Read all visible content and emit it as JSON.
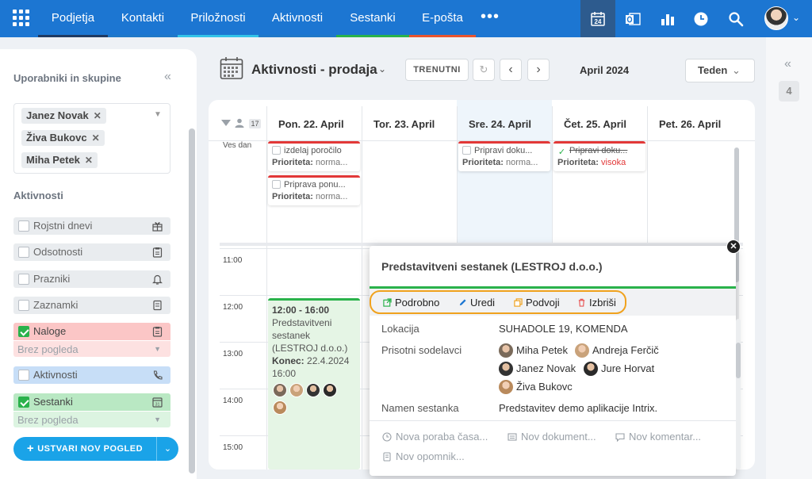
{
  "topnav": {
    "items": [
      {
        "label": "Podjetja",
        "color": "#1f3a63"
      },
      {
        "label": "Kontakti",
        "color": "#1f78c8"
      },
      {
        "label": "Priložnosti",
        "color": "#33c3e8"
      },
      {
        "label": "Aktivnosti",
        "color": "#1f78c8"
      },
      {
        "label": "Sestanki",
        "color": "#2ab24b"
      },
      {
        "label": "E-pošta",
        "color": "#e8542f"
      }
    ],
    "more": "•••",
    "calendar_icon_day": "24"
  },
  "left": {
    "header": "Uporabniki in skupine",
    "users": [
      {
        "name": "Janez Novak",
        "remove": "✕"
      },
      {
        "name": "Živa Bukovc",
        "remove": "✕"
      },
      {
        "name": "Miha Petek",
        "remove": "✕"
      }
    ],
    "activities_title": "Aktivnosti",
    "activities": [
      {
        "label": "Rojstni dnevi",
        "checked": false,
        "bg": "#e9ecef",
        "icon": "gift-icon"
      },
      {
        "label": "Odsotnosti",
        "checked": false,
        "bg": "#e9ecef",
        "icon": "clipboard-icon"
      },
      {
        "label": "Prazniki",
        "checked": false,
        "bg": "#e9ecef",
        "icon": "bell-icon"
      },
      {
        "label": "Zaznamki",
        "checked": false,
        "bg": "#e9ecef",
        "icon": "note-icon"
      },
      {
        "label": "Naloge",
        "checked": true,
        "bg": "#fbc6c6",
        "icon": "clipboard-icon",
        "sub": "Brez pogleda",
        "sub_bg": "#fde1e1"
      },
      {
        "label": "Aktivnosti",
        "checked": false,
        "bg": "#c7def7",
        "icon": "phone-icon"
      },
      {
        "label": "Sestanki",
        "checked": true,
        "bg": "#b9e8c3",
        "icon": "calendar-31-icon",
        "sub": "Brez pogleda",
        "sub_bg": "#dcf4e1"
      }
    ],
    "create_button": "USTVARI NOV POGLED",
    "sub_caret": "▼",
    "users_caret": "▼",
    "collapse": "«"
  },
  "toolbar": {
    "title": "Aktivnosti - prodaja",
    "title_caret": "⌄",
    "today_button": "TRENUTNI",
    "refresh": "↻",
    "prev": "‹",
    "next": "›",
    "date": "April 2024",
    "view": "Teden",
    "view_caret": "⌄"
  },
  "calendar": {
    "week_badge": "17",
    "days": [
      "Pon. 22. April",
      "Tor. 23. April",
      "Sre. 24. April",
      "Čet. 25. April",
      "Pet. 26. April"
    ],
    "all_day_label": "Ves dan",
    "times": [
      "11:00",
      "12:00",
      "13:00",
      "14:00",
      "15:00"
    ],
    "tasks": [
      {
        "title": "izdelaj poročilo",
        "label": "Prioriteta:",
        "priority": "norma...",
        "priority_color": "#777",
        "done": false
      },
      {
        "title": "Priprava ponu...",
        "label": "Prioriteta:",
        "priority": "norma...",
        "priority_color": "#777",
        "done": false
      },
      {
        "title": "Pripravi doku...",
        "label": "Prioriteta:",
        "priority": "norma...",
        "priority_color": "#777",
        "done": false
      },
      {
        "title": "Pripravi doku...",
        "label": "Prioriteta:",
        "priority": "visoka",
        "priority_color": "#e23838",
        "done": true
      }
    ],
    "event": {
      "time": "12:00 - 16:00",
      "title": "Predstavitveni sestanek (LESTROJ d.o.o.)",
      "end_label": "Konec:",
      "end_value": "22.4.2024 16:00"
    }
  },
  "popup": {
    "title": "Predstavitveni sestanek (LESTROJ d.o.o.)",
    "actions": [
      {
        "label": "Podrobno",
        "color": "#2ab24b",
        "icon": "external-link-icon"
      },
      {
        "label": "Uredi",
        "color": "#1c76d2",
        "icon": "pencil-icon"
      },
      {
        "label": "Podvoji",
        "color": "#f0a21e",
        "icon": "copy-icon"
      },
      {
        "label": "Izbriši",
        "color": "#e85858",
        "icon": "trash-icon"
      }
    ],
    "location_label": "Lokacija",
    "location_value": "SUHADOLE 19, KOMENDA",
    "attendees_label": "Prisotni sodelavci",
    "attendees": [
      "Miha Petek",
      "Andreja Ferčič",
      "Janez Novak",
      "Jure Horvat",
      "Živa Bukovc"
    ],
    "purpose_label": "Namen sestanka",
    "purpose_value": "Predstavitev demo aplikacije Intrix.",
    "add_links": [
      "Nova poraba časa...",
      "Nov dokument...",
      "Nov komentar...",
      "Nov opomnik..."
    ],
    "close": "✕"
  },
  "right_rail": {
    "collapse": "«",
    "badge": "4"
  }
}
